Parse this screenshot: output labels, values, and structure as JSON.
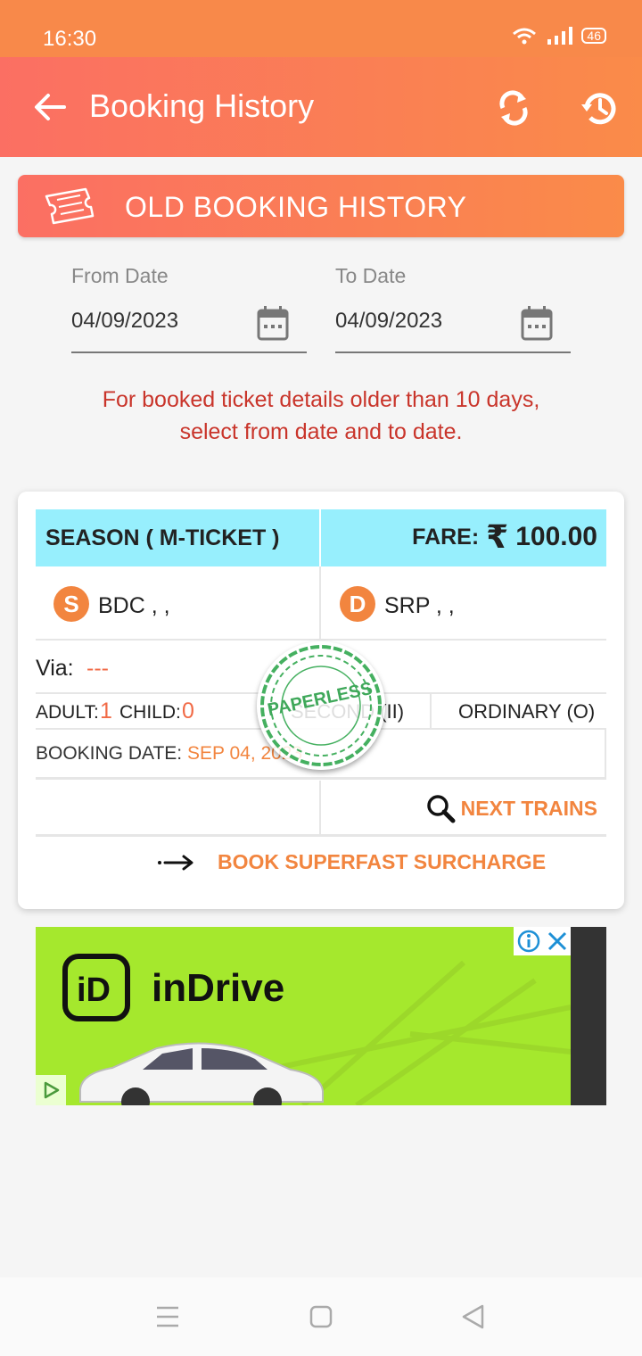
{
  "status_bar": {
    "time": "16:30",
    "battery": "46"
  },
  "app_bar": {
    "title": "Booking History"
  },
  "banner": {
    "label": "OLD BOOKING HISTORY"
  },
  "dates": {
    "from_label": "From Date",
    "from_value": "04/09/2023",
    "to_label": "To Date",
    "to_value": "04/09/2023"
  },
  "hint": {
    "line1": "For booked ticket details older than 10 days,",
    "line2": "select from date and to date."
  },
  "ticket": {
    "type": "SEASON ( M-TICKET )",
    "fare_label": "FARE:",
    "fare_currency": "₹",
    "fare_value": "100.00",
    "source_badge": "S",
    "source": "BDC ,   ,",
    "dest_badge": "D",
    "destination": "SRP ,   ,",
    "via_label": "Via:",
    "via_value": "---",
    "adult_label": "ADULT:",
    "adult_count": "1",
    "child_label": "CHILD:",
    "child_count": "0",
    "class": "SECOND (II)",
    "train_type": "ORDINARY (O)",
    "booking_date_label": "BOOKING DATE:",
    "booking_date_value": "SEP 04, 2023",
    "stamp": "PAPERLESS",
    "next_trains": "NEXT TRAINS",
    "superfast": "BOOK SUPERFAST SURCHARGE"
  },
  "ad": {
    "logo": "iD",
    "brand": "inDrive"
  },
  "colors": {
    "accent": "#f2853f",
    "header_start": "#fb6f63",
    "header_end": "#fa8b49",
    "ticket_header": "#97effd",
    "hint": "#c9352b"
  }
}
